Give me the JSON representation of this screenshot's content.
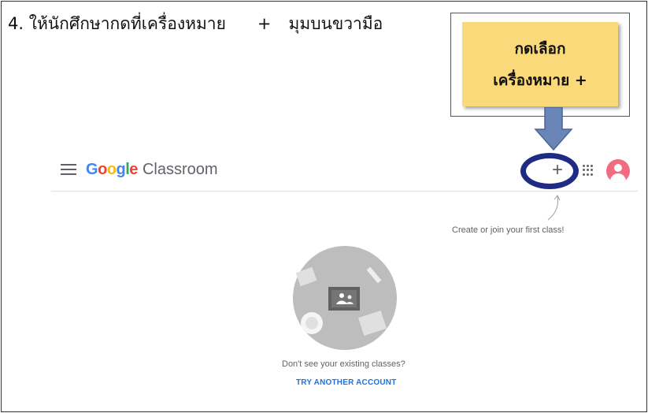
{
  "instruction": {
    "text": "4. ให้นักศึกษากดที่เครื่องหมาย",
    "plus": "+",
    "rest": "มุมบนขวามือ"
  },
  "callout": {
    "line1": "กดเลือก",
    "line2": "เครื่องหมาย +"
  },
  "classroom": {
    "brand_word": "Google",
    "product": "Classroom",
    "plus_label": "+",
    "hint": "Create or join your first class!",
    "question": "Don't see your existing classes?",
    "link": "TRY ANOTHER ACCOUNT"
  },
  "colors": {
    "callout_fill": "#fad97a",
    "arrow": "#6a86b8",
    "ring": "#1f2b84",
    "link": "#1a73e8",
    "avatar": "#f06c7e"
  },
  "icons": [
    "menu-icon",
    "apps-icon",
    "avatar-icon",
    "arrow-down-icon",
    "classroom-illustration"
  ]
}
